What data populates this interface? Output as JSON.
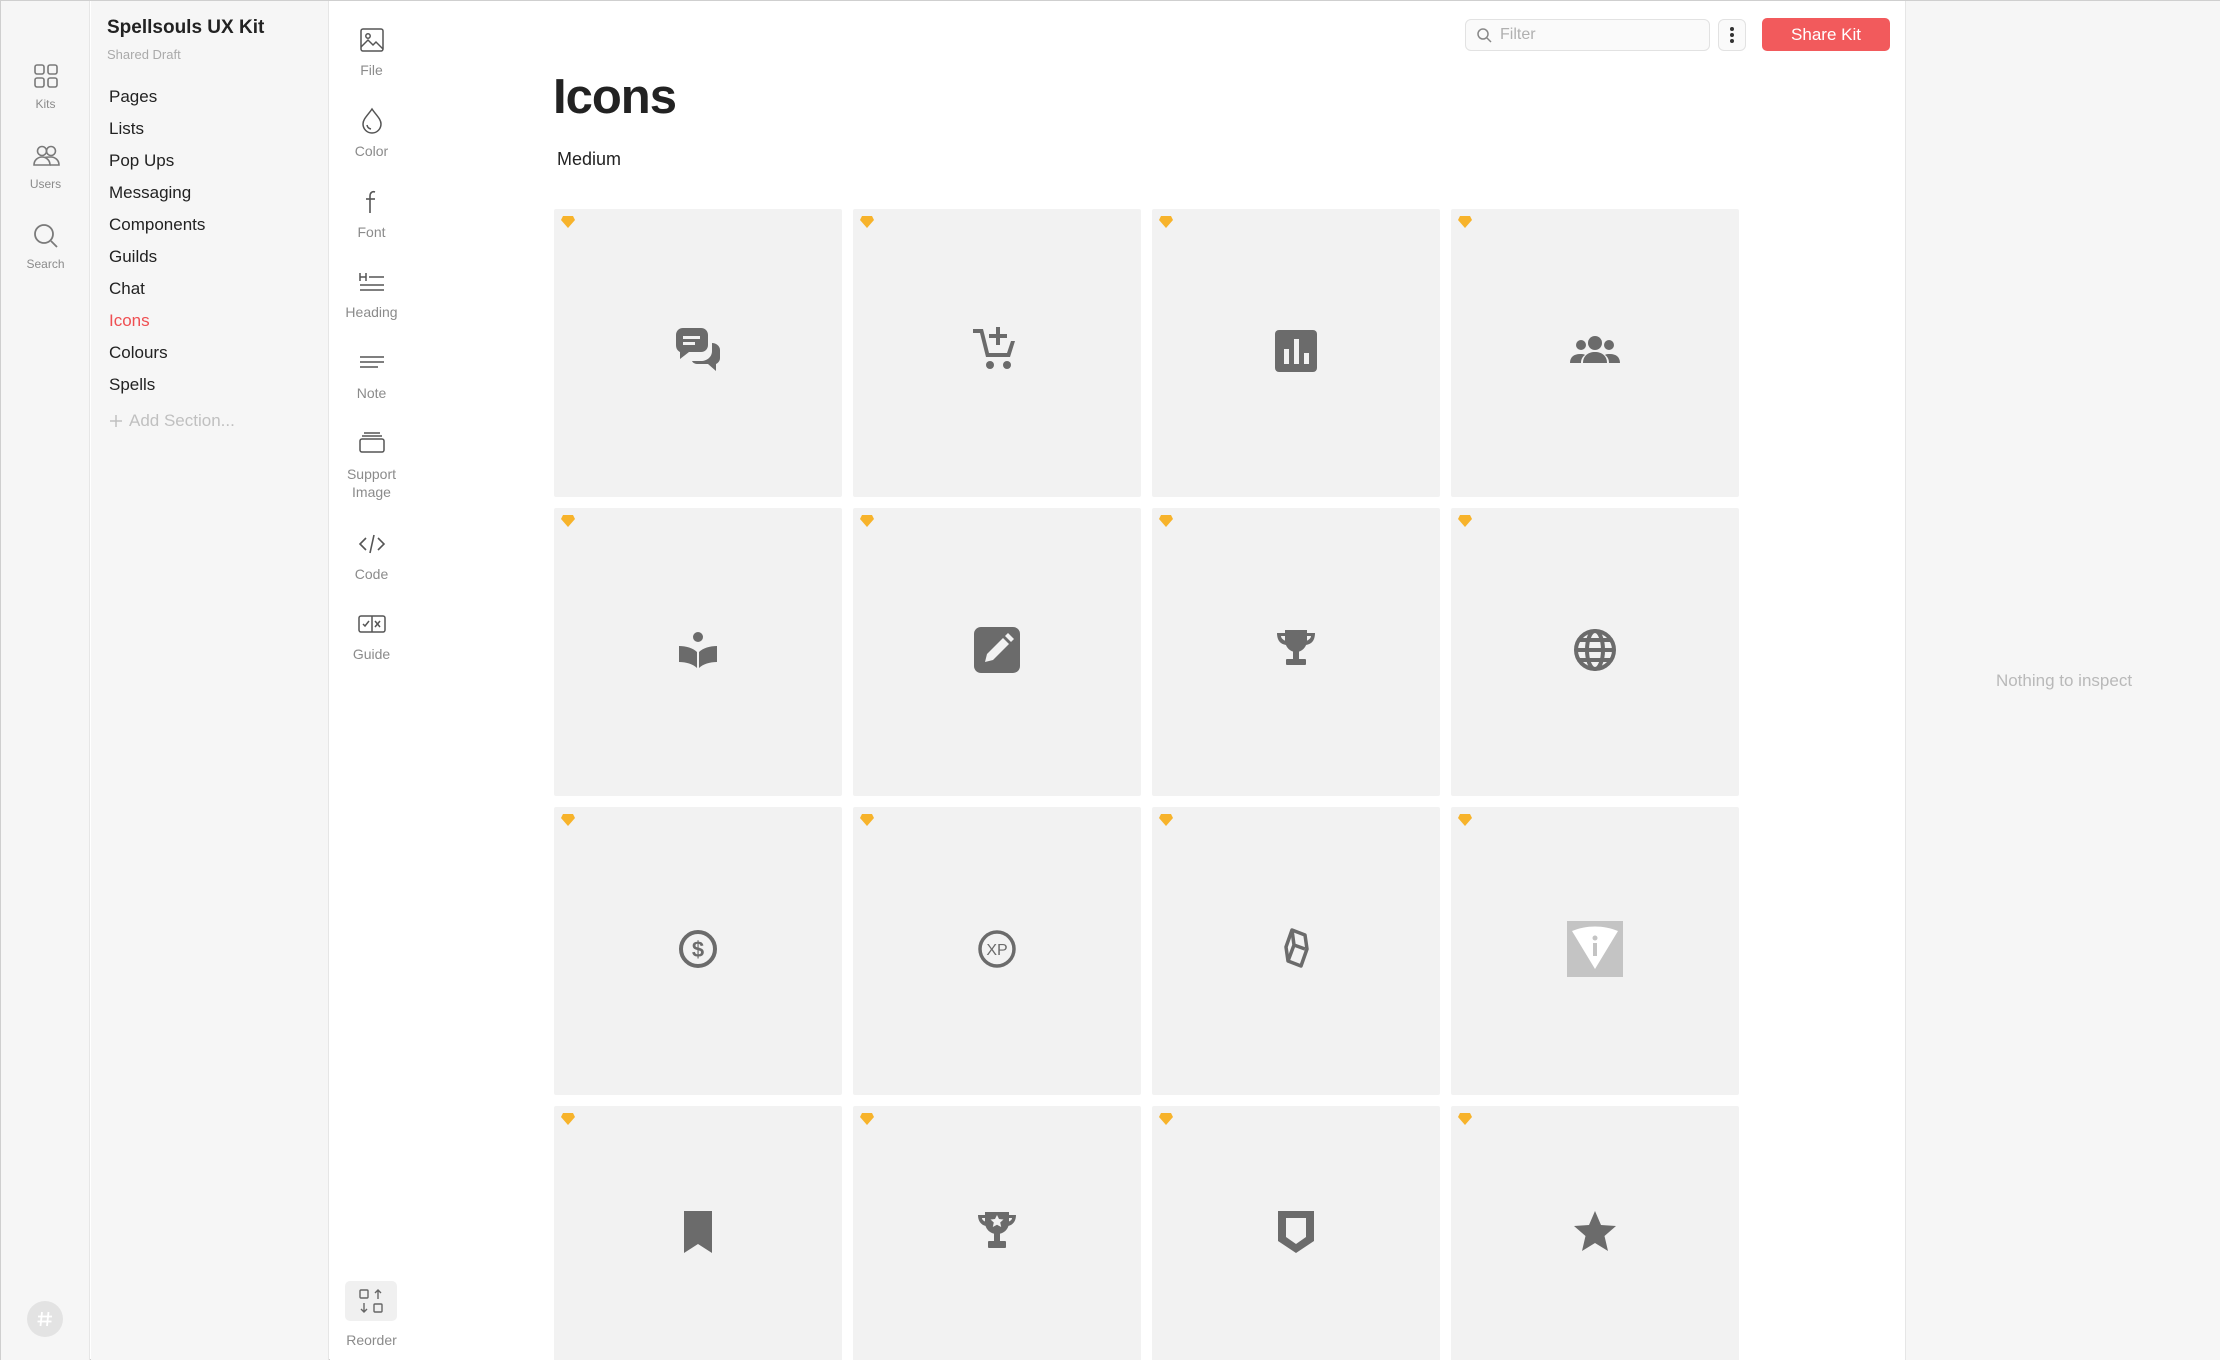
{
  "window": {
    "traffic_lights": [
      "close",
      "minimize",
      "zoom"
    ]
  },
  "rail": {
    "items": [
      {
        "label": "Kits",
        "icon": "grid-icon"
      },
      {
        "label": "Users",
        "icon": "users-icon"
      },
      {
        "label": "Search",
        "icon": "search-icon"
      }
    ],
    "bottom_icon": "hashtag-icon"
  },
  "sidebar": {
    "kit_title": "Spellsouls UX Kit",
    "kit_subtitle": "Shared Draft",
    "sections": [
      {
        "label": "Pages",
        "active": false
      },
      {
        "label": "Lists",
        "active": false
      },
      {
        "label": "Pop Ups",
        "active": false
      },
      {
        "label": "Messaging",
        "active": false
      },
      {
        "label": "Components",
        "active": false
      },
      {
        "label": "Guilds",
        "active": false
      },
      {
        "label": "Chat",
        "active": false
      },
      {
        "label": "Icons",
        "active": true
      },
      {
        "label": "Colours",
        "active": false
      },
      {
        "label": "Spells",
        "active": false
      }
    ],
    "add_section_label": "Add Section..."
  },
  "tools": {
    "items": [
      {
        "label": "File",
        "icon": "image-icon"
      },
      {
        "label": "Color",
        "icon": "drop-icon"
      },
      {
        "label": "Font",
        "icon": "font-icon"
      },
      {
        "label": "Heading",
        "icon": "heading-icon"
      },
      {
        "label": "Note",
        "icon": "note-icon"
      },
      {
        "label": "Support Image",
        "icon": "support-image-icon"
      },
      {
        "label": "Code",
        "icon": "code-icon"
      },
      {
        "label": "Guide",
        "icon": "guide-icon"
      }
    ],
    "reorder_label": "Reorder"
  },
  "toolbar": {
    "filter_placeholder": "Filter",
    "filter_value": "",
    "share_label": "Share Kit"
  },
  "main": {
    "title": "Icons",
    "group_label": "Medium",
    "icons": [
      "chat-bubbles-icon",
      "add-to-cart-icon",
      "bar-chart-icon",
      "group-icon",
      "reading-book-icon",
      "edit-pencil-icon",
      "trophy-icon",
      "globe-icon",
      "coin-dollar-icon",
      "xp-coin-icon",
      "crystal-icon",
      "info-shield-icon",
      "bookmark-icon",
      "award-trophy-icon",
      "banner-shield-icon",
      "star-icon"
    ]
  },
  "inspector": {
    "empty_text": "Nothing to inspect"
  },
  "colors": {
    "accent": "#f25a5c",
    "active_section": "#ef4f52",
    "icon_gray": "#6b6b6b",
    "gem": "#f7b32b",
    "tile": "#f2f2f2"
  }
}
